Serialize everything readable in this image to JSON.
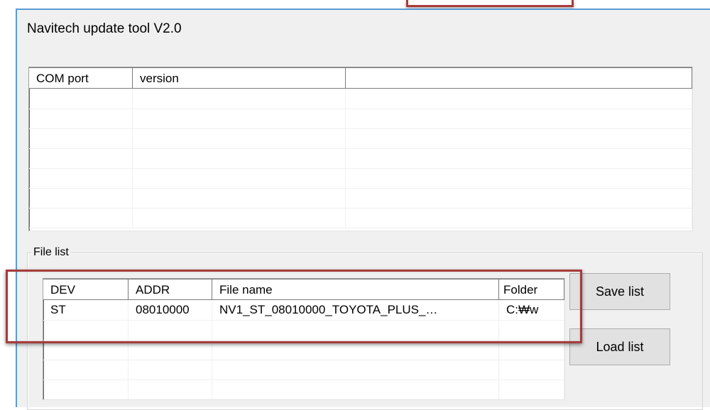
{
  "window": {
    "title": "Navitech update tool V2.0"
  },
  "port_list": {
    "columns": [
      "COM port",
      "version",
      ""
    ],
    "rows": [
      [
        "",
        "",
        ""
      ],
      [
        "",
        "",
        ""
      ],
      [
        "",
        "",
        ""
      ],
      [
        "",
        "",
        ""
      ],
      [
        "",
        "",
        ""
      ],
      [
        "",
        "",
        ""
      ],
      [
        "",
        "",
        ""
      ]
    ]
  },
  "file_list": {
    "group_label": "File list",
    "columns": [
      "DEV",
      "ADDR",
      "File name",
      "Folder"
    ],
    "rows": [
      [
        "ST",
        "08010000",
        "NV1_ST_08010000_TOYOTA_PLUS_…",
        "C:₩w"
      ],
      [
        "",
        "",
        "",
        ""
      ],
      [
        "",
        "",
        "",
        ""
      ],
      [
        "",
        "",
        "",
        ""
      ],
      [
        "",
        "",
        "",
        ""
      ]
    ]
  },
  "buttons": {
    "save_list": "Save list",
    "load_list": "Load list"
  },
  "colors": {
    "annotation": "#a73b3b",
    "window_border": "#5b9bd5"
  }
}
